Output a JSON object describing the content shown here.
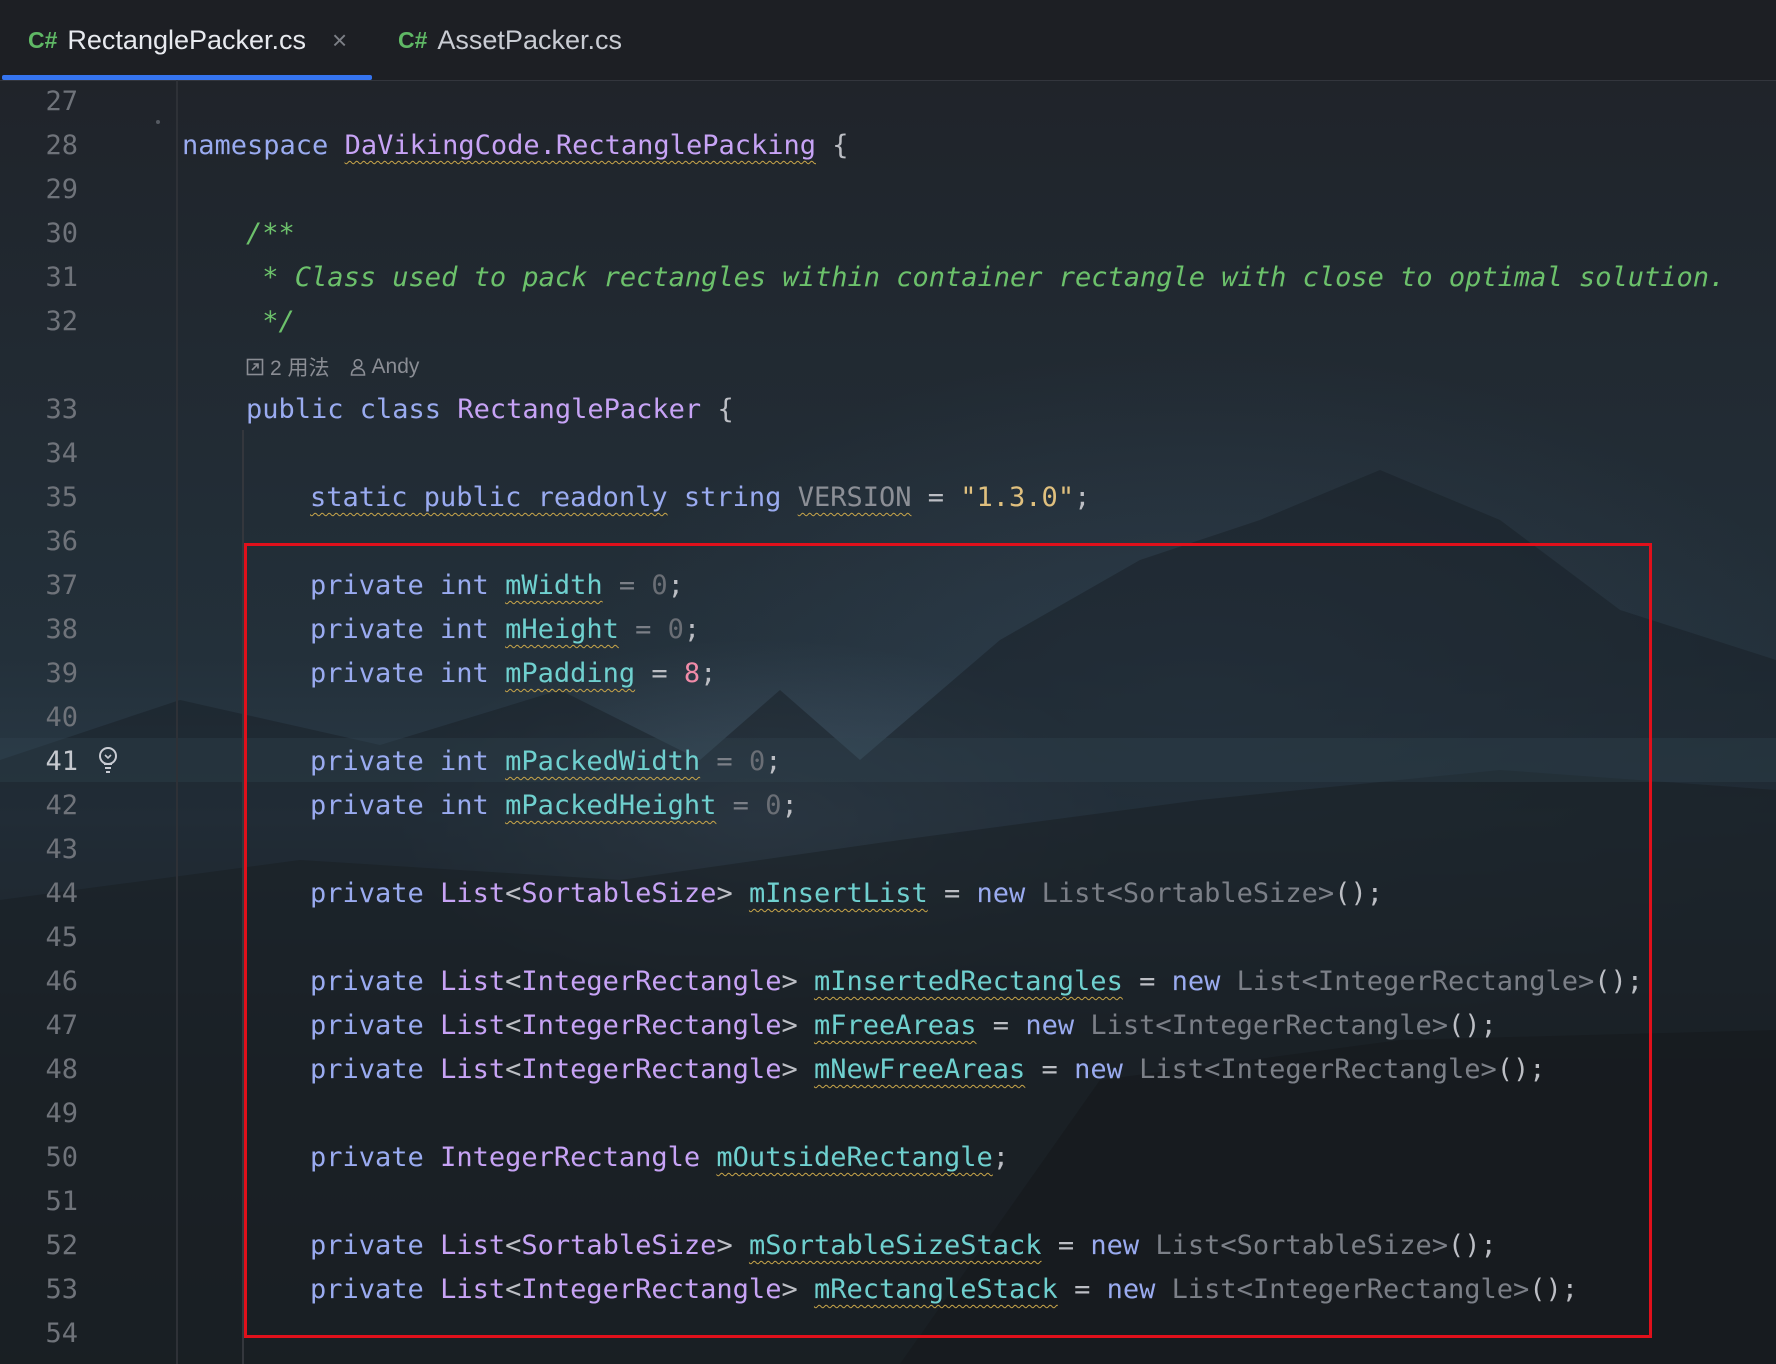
{
  "tabs": [
    {
      "lang": "C#",
      "label": "RectanglePacker.cs",
      "close": "×"
    },
    {
      "lang": "C#",
      "label": "AssetPacker.cs"
    }
  ],
  "inlay_hint": {
    "usages": "2 用法",
    "author": "Andy"
  },
  "lines": [
    {
      "n": "27"
    },
    {
      "n": "28",
      "tokens": [
        [
          "namespace",
          "kw"
        ],
        [
          " ",
          "plain"
        ],
        [
          "DaVikingCode.RectanglePacking",
          "nsname"
        ],
        [
          " {",
          "plain"
        ]
      ]
    },
    {
      "n": "29"
    },
    {
      "n": "30",
      "tokens": [
        [
          "/**",
          "comment"
        ]
      ]
    },
    {
      "n": "31",
      "tokens": [
        [
          " * Class used to pack rectangles within container rectangle with close to optimal solution.",
          "comment"
        ]
      ]
    },
    {
      "n": "32",
      "tokens": [
        [
          " */",
          "comment"
        ]
      ]
    },
    {
      "n": "33",
      "tokens": [
        [
          "public class",
          "kw"
        ],
        [
          " ",
          "plain"
        ],
        [
          "RectanglePacker",
          "type"
        ],
        [
          " {",
          "plain"
        ]
      ]
    },
    {
      "n": "34"
    },
    {
      "n": "35",
      "tokens": [
        [
          "static public readonly",
          "kw kw-under"
        ],
        [
          " ",
          "plain"
        ],
        [
          "string",
          "kw"
        ],
        [
          " ",
          "plain"
        ],
        [
          "VERSION",
          "ver"
        ],
        [
          " = ",
          "plain"
        ],
        [
          "\"1.3.0\"",
          "str"
        ],
        [
          ";",
          "plain"
        ]
      ]
    },
    {
      "n": "36"
    },
    {
      "n": "37",
      "tokens": [
        [
          "private int",
          "kw"
        ],
        [
          " ",
          "plain"
        ],
        [
          "mWidth",
          "field"
        ],
        [
          " = ",
          "dim"
        ],
        [
          "0",
          "num-dim"
        ],
        [
          ";",
          "plain"
        ]
      ]
    },
    {
      "n": "38",
      "tokens": [
        [
          "private int",
          "kw"
        ],
        [
          " ",
          "plain"
        ],
        [
          "mHeight",
          "field"
        ],
        [
          " = ",
          "dim"
        ],
        [
          "0",
          "num-dim"
        ],
        [
          ";",
          "plain"
        ]
      ]
    },
    {
      "n": "39",
      "tokens": [
        [
          "private int",
          "kw"
        ],
        [
          " ",
          "plain"
        ],
        [
          "mPadding",
          "field"
        ],
        [
          " = ",
          "plain"
        ],
        [
          "8",
          "num"
        ],
        [
          ";",
          "plain"
        ]
      ]
    },
    {
      "n": "40"
    },
    {
      "n": "41",
      "tokens": [
        [
          "private int",
          "kw"
        ],
        [
          " ",
          "plain"
        ],
        [
          "mPackedWidth",
          "field"
        ],
        [
          " = ",
          "dim"
        ],
        [
          "0",
          "num-dim"
        ],
        [
          ";",
          "plain"
        ]
      ]
    },
    {
      "n": "42",
      "tokens": [
        [
          "private int",
          "kw"
        ],
        [
          " ",
          "plain"
        ],
        [
          "mPackedHeight",
          "field"
        ],
        [
          " = ",
          "dim"
        ],
        [
          "0",
          "num-dim"
        ],
        [
          ";",
          "plain"
        ]
      ]
    },
    {
      "n": "43"
    },
    {
      "n": "44",
      "tokens": [
        [
          "private",
          "kw"
        ],
        [
          " ",
          "plain"
        ],
        [
          "List",
          "type"
        ],
        [
          "<",
          "plain"
        ],
        [
          "SortableSize",
          "type"
        ],
        [
          "> ",
          "plain"
        ],
        [
          "mInsertList",
          "field"
        ],
        [
          " = ",
          "plain"
        ],
        [
          "new",
          "kw"
        ],
        [
          " ",
          "plain"
        ],
        [
          "List<SortableSize>",
          "dim"
        ],
        [
          "();",
          "plain"
        ]
      ]
    },
    {
      "n": "45"
    },
    {
      "n": "46",
      "tokens": [
        [
          "private",
          "kw"
        ],
        [
          " ",
          "plain"
        ],
        [
          "List",
          "type"
        ],
        [
          "<",
          "plain"
        ],
        [
          "IntegerRectangle",
          "type"
        ],
        [
          "> ",
          "plain"
        ],
        [
          "mInsertedRectangles",
          "field"
        ],
        [
          " = ",
          "plain"
        ],
        [
          "new",
          "kw"
        ],
        [
          " ",
          "plain"
        ],
        [
          "List<IntegerRectangle>",
          "dim"
        ],
        [
          "();",
          "plain"
        ]
      ]
    },
    {
      "n": "47",
      "tokens": [
        [
          "private",
          "kw"
        ],
        [
          " ",
          "plain"
        ],
        [
          "List",
          "type"
        ],
        [
          "<",
          "plain"
        ],
        [
          "IntegerRectangle",
          "type"
        ],
        [
          "> ",
          "plain"
        ],
        [
          "mFreeAreas",
          "field"
        ],
        [
          " = ",
          "plain"
        ],
        [
          "new",
          "kw"
        ],
        [
          " ",
          "plain"
        ],
        [
          "List<IntegerRectangle>",
          "dim"
        ],
        [
          "();",
          "plain"
        ]
      ]
    },
    {
      "n": "48",
      "tokens": [
        [
          "private",
          "kw"
        ],
        [
          " ",
          "plain"
        ],
        [
          "List",
          "type"
        ],
        [
          "<",
          "plain"
        ],
        [
          "IntegerRectangle",
          "type"
        ],
        [
          "> ",
          "plain"
        ],
        [
          "mNewFreeAreas",
          "field"
        ],
        [
          " = ",
          "plain"
        ],
        [
          "new",
          "kw"
        ],
        [
          " ",
          "plain"
        ],
        [
          "List<IntegerRectangle>",
          "dim"
        ],
        [
          "();",
          "plain"
        ]
      ]
    },
    {
      "n": "49"
    },
    {
      "n": "50",
      "tokens": [
        [
          "private",
          "kw"
        ],
        [
          " ",
          "plain"
        ],
        [
          "IntegerRectangle",
          "type"
        ],
        [
          " ",
          "plain"
        ],
        [
          "mOutsideRectangle",
          "field"
        ],
        [
          ";",
          "plain"
        ]
      ]
    },
    {
      "n": "51"
    },
    {
      "n": "52",
      "tokens": [
        [
          "private",
          "kw"
        ],
        [
          " ",
          "plain"
        ],
        [
          "List",
          "type"
        ],
        [
          "<",
          "plain"
        ],
        [
          "SortableSize",
          "type"
        ],
        [
          "> ",
          "plain"
        ],
        [
          "mSortableSizeStack",
          "field"
        ],
        [
          " = ",
          "plain"
        ],
        [
          "new",
          "kw"
        ],
        [
          " ",
          "plain"
        ],
        [
          "List<SortableSize>",
          "dim"
        ],
        [
          "();",
          "plain"
        ]
      ]
    },
    {
      "n": "53",
      "tokens": [
        [
          "private",
          "kw"
        ],
        [
          " ",
          "plain"
        ],
        [
          "List",
          "type"
        ],
        [
          "<",
          "plain"
        ],
        [
          "IntegerRectangle",
          "type"
        ],
        [
          "> ",
          "plain"
        ],
        [
          "mRectangleStack",
          "field"
        ],
        [
          " = ",
          "plain"
        ],
        [
          "new",
          "kw"
        ],
        [
          " ",
          "plain"
        ],
        [
          "List<IntegerRectangle>",
          "dim"
        ],
        [
          "();",
          "plain"
        ]
      ]
    },
    {
      "n": "54"
    }
  ],
  "colors": {
    "background": "#1e2025",
    "keyword": "#9aabf0",
    "type": "#c7a3f5",
    "field": "#6fd0cf",
    "comment": "#6cc16b",
    "string": "#e0c07e",
    "number": "#f08ba8",
    "selection_border": "#e0101b",
    "tab_underline": "#3574f0"
  },
  "icons": [
    "csharp-icon",
    "close-icon",
    "usages-icon",
    "user-icon",
    "lightbulb-icon"
  ]
}
